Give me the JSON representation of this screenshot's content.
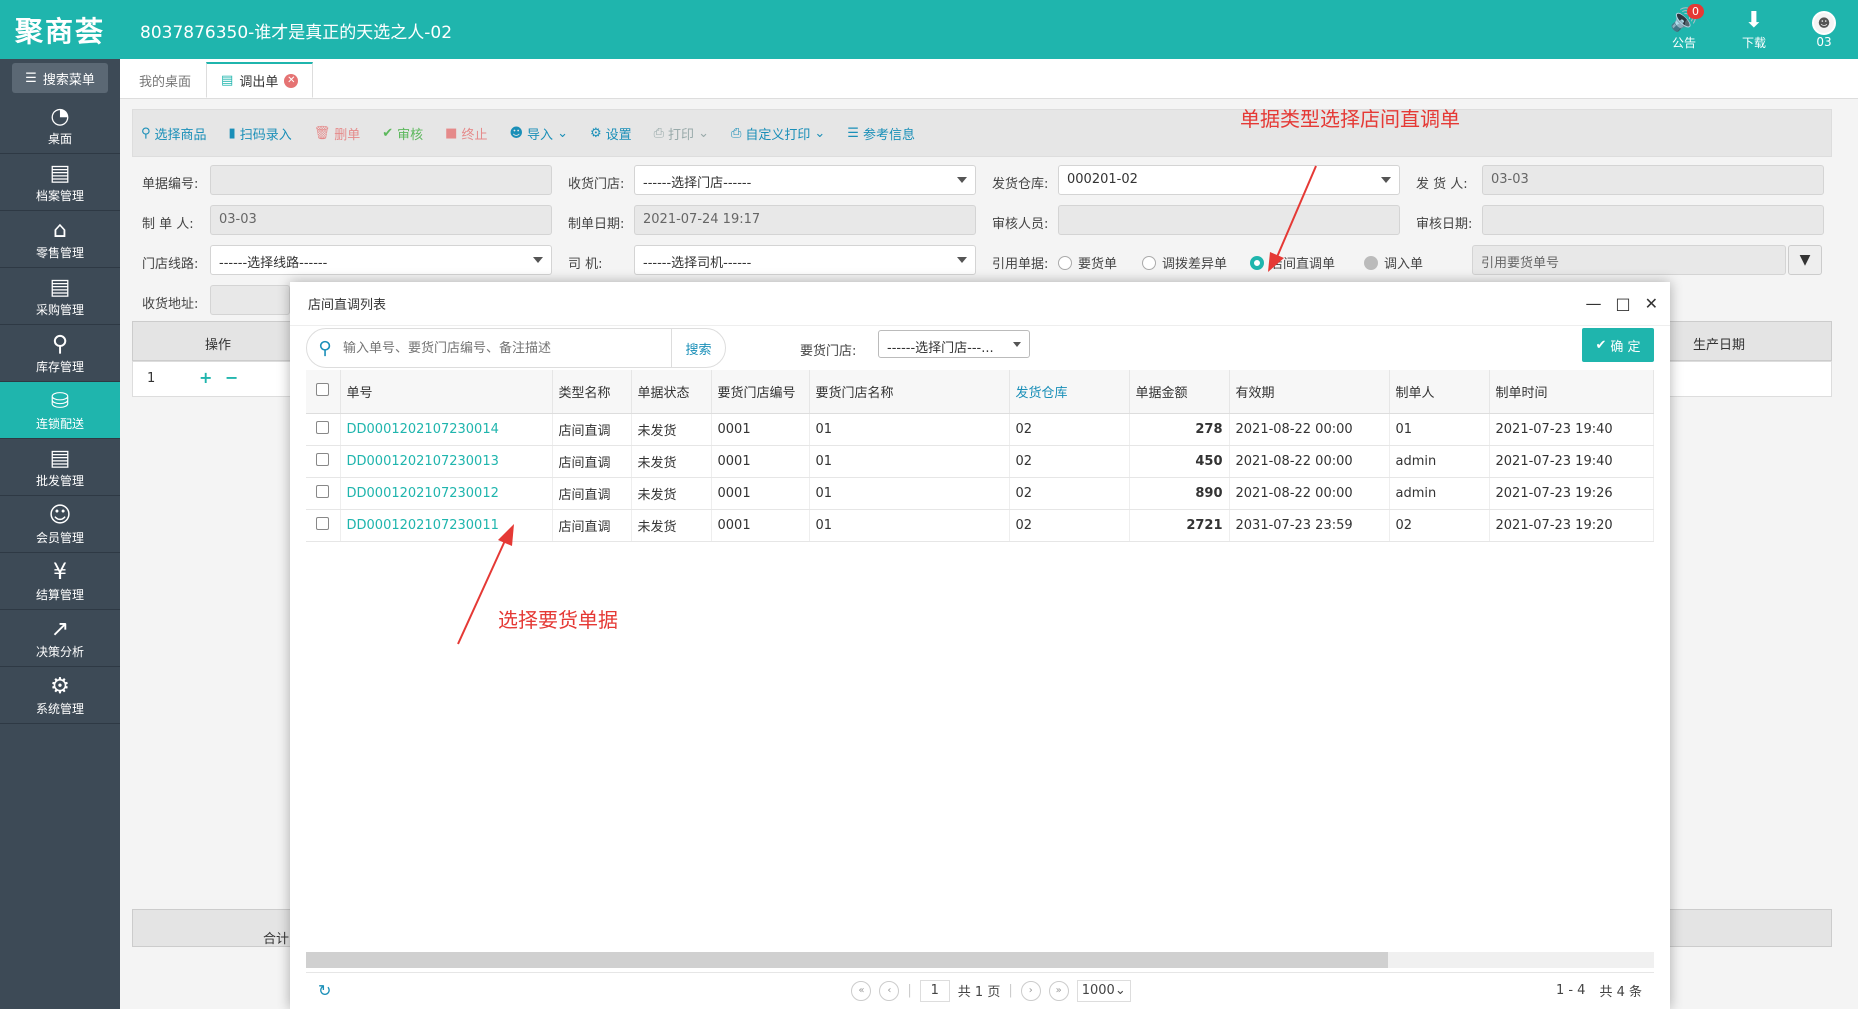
{
  "app": {
    "logo": "聚商荟",
    "title": "8037876350-谁才是真正的天选之人-02",
    "top_icons": [
      {
        "name": "notice",
        "label": "公告",
        "badge": "0"
      },
      {
        "name": "download",
        "label": "下载"
      },
      {
        "name": "user",
        "label": "03"
      }
    ]
  },
  "sidebar": {
    "search_label": "搜索菜单",
    "items": [
      {
        "label": "桌面",
        "icon": "dashboard-icon"
      },
      {
        "label": "档案管理",
        "icon": "archive-icon"
      },
      {
        "label": "零售管理",
        "icon": "store-icon"
      },
      {
        "label": "采购管理",
        "icon": "cart-icon"
      },
      {
        "label": "库存管理",
        "icon": "inventory-icon"
      },
      {
        "label": "连锁配送",
        "icon": "delivery-icon",
        "active": true
      },
      {
        "label": "批发管理",
        "icon": "wholesale-icon"
      },
      {
        "label": "会员管理",
        "icon": "member-icon"
      },
      {
        "label": "结算管理",
        "icon": "settlement-icon"
      },
      {
        "label": "决策分析",
        "icon": "analysis-icon"
      },
      {
        "label": "系统管理",
        "icon": "settings-icon"
      }
    ]
  },
  "tabs": [
    {
      "label": "我的桌面"
    },
    {
      "label": "调出单",
      "active": true
    }
  ],
  "toolbar": {
    "select_goods": "选择商品",
    "scan": "扫码录入",
    "delete": "删单",
    "audit": "审核",
    "stop": "终止",
    "import": "导入",
    "settings": "设置",
    "print": "打印",
    "custom_print": "自定义打印",
    "reference": "参考信息"
  },
  "annotations": {
    "top": "单据类型选择店间直调单",
    "bottom": "选择要货单据"
  },
  "form": {
    "doc_no_label": "单据编号:",
    "doc_no": "",
    "recv_store_label": "收货门店:",
    "recv_store": "------选择门店------",
    "ship_wh_label": "发货仓库:",
    "ship_wh": "000201-02",
    "shipper_label": "发 货 人:",
    "shipper": "03-03",
    "maker_label": "制 单 人:",
    "maker": "03-03",
    "make_date_label": "制单日期:",
    "make_date": "2021-07-24 19:17",
    "auditor_label": "审核人员:",
    "audit_date_label": "审核日期:",
    "route_label": "门店线路:",
    "route": "------选择线路------",
    "driver_label": "司      机:",
    "driver": "------选择司机------",
    "ref_label": "引用单据:",
    "ref_options": [
      "要货单",
      "调拨差异单",
      "店间直调单",
      "调入单"
    ],
    "ref_selected": 2,
    "ref_placeholder": "引用要货单号",
    "addr_label": "收货地址:"
  },
  "grid": {
    "op_label": "操作",
    "prod_date_label": "生产日期",
    "row_no": "1",
    "total_label": "合计"
  },
  "modal": {
    "title": "店间直调列表",
    "search_placeholder": "输入单号、要货门店编号、备注描述",
    "search_btn": "搜索",
    "store_label": "要货门店:",
    "store_value": "------选择门店---...",
    "confirm": "确 定",
    "columns": [
      "单号",
      "类型名称",
      "单据状态",
      "要货门店编号",
      "要货门店名称",
      "发货仓库",
      "单据金额",
      "有效期",
      "制单人",
      "制单时间"
    ],
    "rows": [
      {
        "no": "DD0001202107230014",
        "type": "店间直调",
        "status": "未发货",
        "store_code": "0001",
        "store_name": "01",
        "warehouse": "02",
        "amount": "278",
        "valid": "2021-08-22 00:00",
        "maker": "01",
        "time": "2021-07-23 19:40"
      },
      {
        "no": "DD0001202107230013",
        "type": "店间直调",
        "status": "未发货",
        "store_code": "0001",
        "store_name": "01",
        "warehouse": "02",
        "amount": "450",
        "valid": "2021-08-22 00:00",
        "maker": "admin",
        "time": "2021-07-23 19:40"
      },
      {
        "no": "DD0001202107230012",
        "type": "店间直调",
        "status": "未发货",
        "store_code": "0001",
        "store_name": "01",
        "warehouse": "02",
        "amount": "890",
        "valid": "2021-08-22 00:00",
        "maker": "admin",
        "time": "2021-07-23 19:26"
      },
      {
        "no": "DD0001202107230011",
        "type": "店间直调",
        "status": "未发货",
        "store_code": "0001",
        "store_name": "01",
        "warehouse": "02",
        "amount": "2721",
        "valid": "2031-07-23 23:59",
        "maker": "02",
        "time": "2021-07-23 19:20"
      }
    ],
    "pager": {
      "page": "1",
      "total_pages": "共 1 页",
      "page_size": "1000",
      "range": "1 - 4",
      "total": "共 4 条"
    }
  },
  "colors": {
    "accent": "#1fb5ad",
    "sidebar": "#3d4a56",
    "annotation": "#e53935"
  }
}
